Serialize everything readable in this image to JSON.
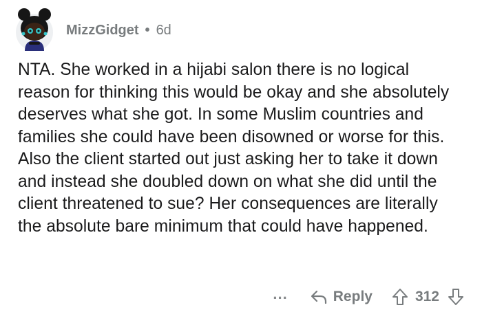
{
  "comment": {
    "author": "MizzGidget",
    "separator": "•",
    "age": "6d",
    "body": "NTA. She worked in a hijabi salon there is no logical reason for thinking this would be okay and she absolutely deserves what she got. In some Muslim countries and families she could have been disowned or worse for this. Also the client started out just asking her to take it down and instead she doubled down on what she did until the client threatened to sue? Her consequences are literally the absolute bare minimum that could have happened.",
    "avatar_icon": "snoo-avatar-icon"
  },
  "actions": {
    "more_label": "...",
    "reply_label": "Reply",
    "reply_icon": "reply-arrow-icon",
    "upvote_icon": "upvote-arrow-icon",
    "downvote_icon": "downvote-arrow-icon",
    "score": "312"
  },
  "colors": {
    "text": "#1a1a1b",
    "meta": "#787c7e",
    "avatar_accent": "#36c4c7",
    "avatar_shirt": "#2a2f7a"
  }
}
